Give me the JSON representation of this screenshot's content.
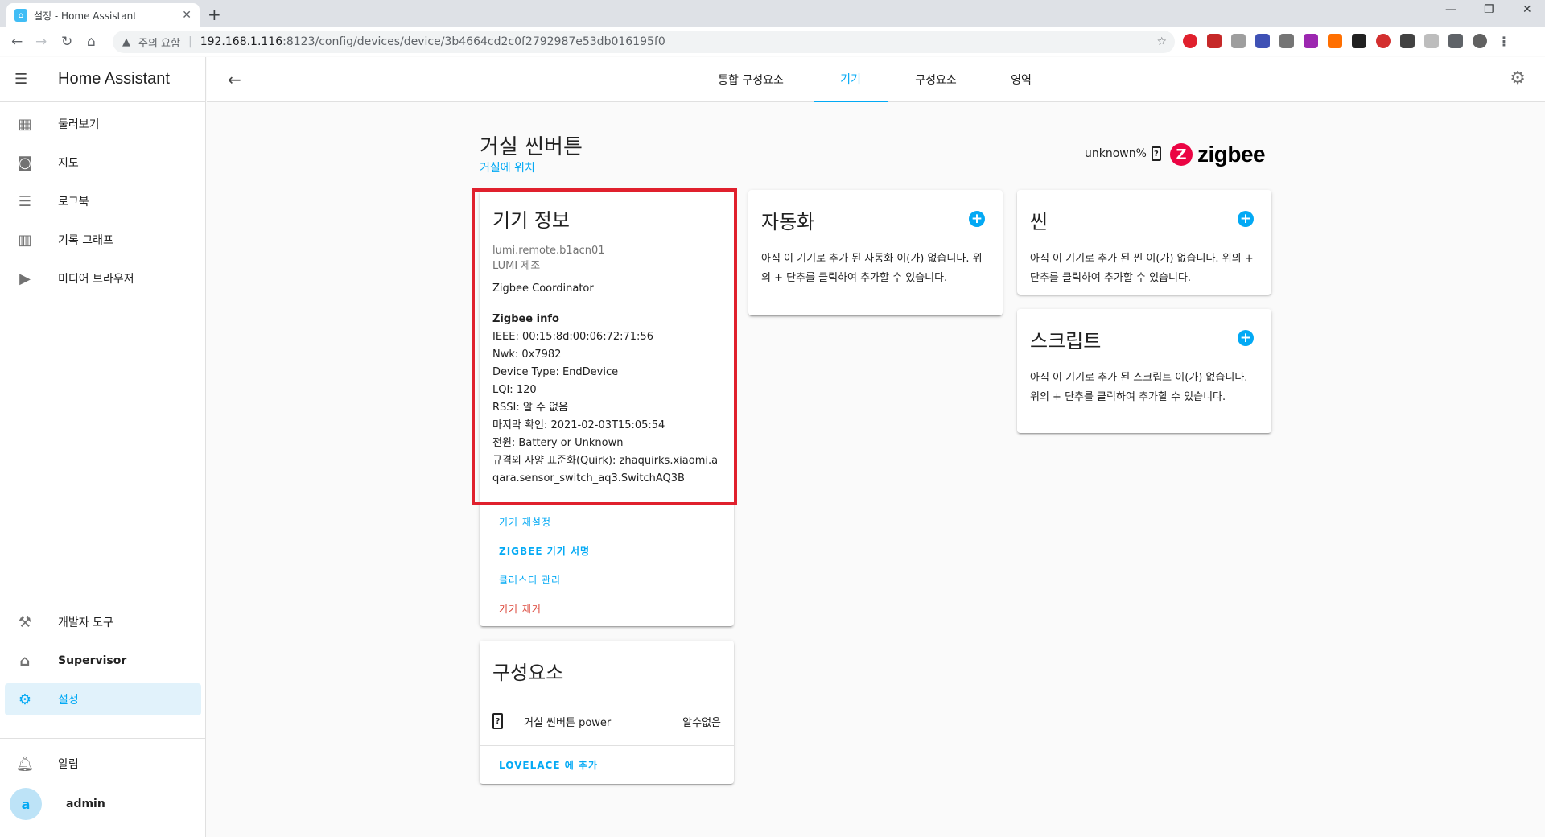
{
  "browser": {
    "tab_title": "설정 - Home Assistant",
    "security_label": "주의 요함",
    "url_host": "192.168.1.116",
    "url_path": ":8123/config/devices/device/3b4664cd2c0f2792987e53db016195f0"
  },
  "sidebar": {
    "app_title": "Home Assistant",
    "items": [
      {
        "label": "둘러보기",
        "icon": "dashboard-icon"
      },
      {
        "label": "지도",
        "icon": "map-icon"
      },
      {
        "label": "로그북",
        "icon": "logbook-icon"
      },
      {
        "label": "기록 그래프",
        "icon": "history-icon"
      },
      {
        "label": "미디어 브라우저",
        "icon": "media-icon"
      }
    ],
    "bottom_items": [
      {
        "label": "개발자 도구",
        "icon": "hammer-icon"
      },
      {
        "label": "Supervisor",
        "icon": "supervisor-icon"
      },
      {
        "label": "설정",
        "icon": "settings-icon"
      }
    ],
    "notifications_label": "알림",
    "user_initial": "a",
    "user_name": "admin"
  },
  "topbar": {
    "tabs": [
      "통합 구성요소",
      "기기",
      "구성요소",
      "영역"
    ],
    "active_tab": "기기"
  },
  "device": {
    "name": "거실 씬버튼",
    "area": "거실에 위치",
    "battery": "unknown%",
    "integration": "zigbee"
  },
  "device_info": {
    "title": "기기 정보",
    "model": "lumi.remote.b1acn01",
    "manufacturer": "LUMI 제조",
    "via": "Zigbee Coordinator",
    "zigbee_header": "Zigbee info",
    "lines": [
      "IEEE: 00:15:8d:00:06:72:71:56",
      "Nwk: 0x7982",
      "Device Type: EndDevice",
      "LQI: 120",
      "RSSI: 알 수 없음",
      "마지막 확인: 2021-02-03T15:05:54",
      "전원: Battery or Unknown"
    ],
    "quirk_line1": "규격외 사양 표준화(Quirk): zhaquirks.xiaomi.a",
    "quirk_line2": "qara.sensor_switch_aq3.SwitchAQ3B",
    "actions": {
      "reconfigure": "기기 재설정",
      "signature": "ZIGBEE 기기 서명",
      "clusters": "클러스터 관리",
      "remove": "기기 제거"
    }
  },
  "entities_card": {
    "title": "구성요소",
    "entity_name": "거실 씬버튼 power",
    "entity_state": "알수없음",
    "add_lovelace": "LOVELACE 에 추가"
  },
  "automation_card": {
    "title": "자동화",
    "text": "아직 이 기기로 추가 된 자동화 이(가) 없습니다. 위의 + 단추를 클릭하여 추가할 수 있습니다."
  },
  "scene_card": {
    "title": "씬",
    "text": "아직 이 기기로 추가 된 씬 이(가) 없습니다. 위의 + 단추를 클릭하여 추가할 수 있습니다."
  },
  "script_card": {
    "title": "스크립트",
    "text": "아직 이 기기로 추가 된 스크립트 이(가) 없습니다. 위의 + 단추를 클릭하여 추가할 수 있습니다."
  },
  "colors": {
    "accent": "#03a9f4",
    "highlight": "#e0202d",
    "danger": "#db4437",
    "zigbee_brand": "#eb0443"
  }
}
